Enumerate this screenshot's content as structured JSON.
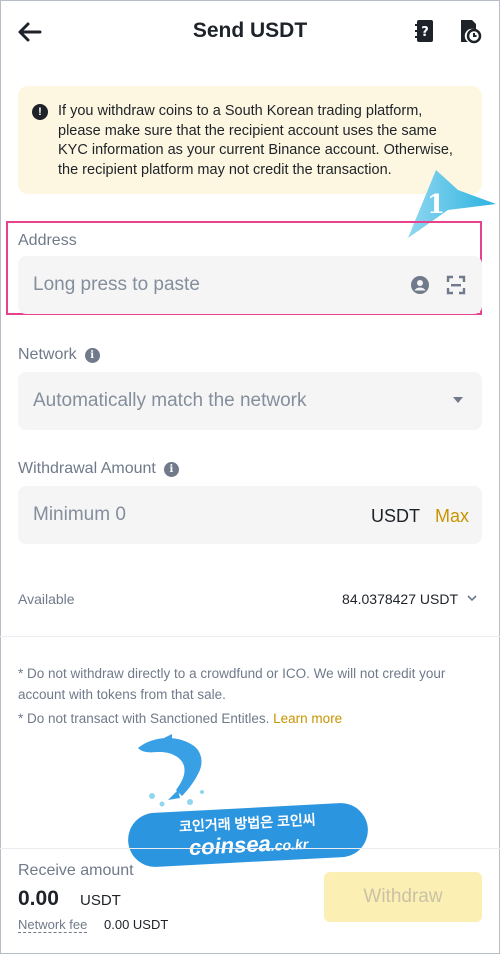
{
  "header": {
    "title": "Send USDT",
    "back_icon": "arrow-left-icon",
    "faq_icon": "question-document-icon",
    "history_icon": "document-clock-icon"
  },
  "notice": {
    "icon": "exclamation-circle-icon",
    "text": "If you withdraw coins to a South Korean trading platform, please make sure that the recipient account uses the same KYC information as your current Binance account. Otherwise, the recipient platform may not credit the transaction."
  },
  "callout": {
    "number": "1",
    "color": "#2bb2e0"
  },
  "address": {
    "label": "Address",
    "placeholder": "Long press to paste",
    "contact_icon": "person-circle-icon",
    "scan_icon": "qr-scan-icon"
  },
  "network": {
    "label": "Network",
    "placeholder": "Automatically match the network",
    "dropdown_icon": "caret-down-icon"
  },
  "amount": {
    "label": "Withdrawal Amount",
    "placeholder": "Minimum 0",
    "unit": "USDT",
    "max_label": "Max"
  },
  "available": {
    "label": "Available",
    "value": "84.0378427 USDT"
  },
  "notes": {
    "line1": "* Do not withdraw directly to a crowdfund or ICO. We will not credit your account with tokens from that sale.",
    "line2_prefix": "* Do not transact with Sanctioned Entitles.",
    "learn_more": "Learn more"
  },
  "watermark": {
    "line1": "코인거래 방법은 코인씨",
    "line2": "coinsea",
    "line2_suffix": ".co.kr"
  },
  "footer": {
    "receive_label": "Receive amount",
    "receive_value": "0.00",
    "receive_unit": "USDT",
    "fee_label": "Network fee",
    "fee_value": "0.00 USDT",
    "withdraw_label": "Withdraw"
  },
  "colors": {
    "accent": "#c99400",
    "highlight_border": "#e8418e",
    "notice_bg": "#fdf6e0",
    "button_disabled_bg": "#fcefb4"
  }
}
